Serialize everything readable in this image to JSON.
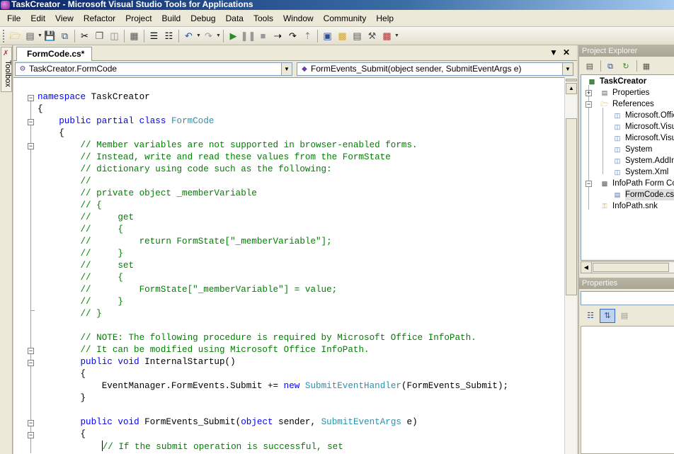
{
  "window": {
    "title": "TaskCreator - Microsoft Visual Studio Tools for Applications"
  },
  "menu": [
    "File",
    "Edit",
    "View",
    "Refactor",
    "Project",
    "Build",
    "Debug",
    "Data",
    "Tools",
    "Window",
    "Community",
    "Help"
  ],
  "toolbox": {
    "label": "Toolbox"
  },
  "editor": {
    "tab_label": "FormCode.cs*",
    "type_combo": "TaskCreator.FormCode",
    "member_combo": "FormEvents_Submit(object sender, SubmitEventArgs e)",
    "code_lines": [
      [
        {
          "t": "namespace",
          "c": "kw"
        },
        {
          "t": " TaskCreator",
          "c": ""
        }
      ],
      [
        {
          "t": "{",
          "c": ""
        }
      ],
      [
        {
          "t": "    ",
          "c": ""
        },
        {
          "t": "public",
          "c": "kw"
        },
        {
          "t": " ",
          "c": ""
        },
        {
          "t": "partial",
          "c": "kw"
        },
        {
          "t": " ",
          "c": ""
        },
        {
          "t": "class",
          "c": "kw"
        },
        {
          "t": " ",
          "c": ""
        },
        {
          "t": "FormCode",
          "c": "ty"
        }
      ],
      [
        {
          "t": "    {",
          "c": ""
        }
      ],
      [
        {
          "t": "        ",
          "c": ""
        },
        {
          "t": "// Member variables are not supported in browser-enabled forms.",
          "c": "cm"
        }
      ],
      [
        {
          "t": "        ",
          "c": ""
        },
        {
          "t": "// Instead, write and read these values from the FormState",
          "c": "cm"
        }
      ],
      [
        {
          "t": "        ",
          "c": ""
        },
        {
          "t": "// dictionary using code such as the following:",
          "c": "cm"
        }
      ],
      [
        {
          "t": "        ",
          "c": ""
        },
        {
          "t": "//",
          "c": "cm"
        }
      ],
      [
        {
          "t": "        ",
          "c": ""
        },
        {
          "t": "// private object _memberVariable",
          "c": "cm"
        }
      ],
      [
        {
          "t": "        ",
          "c": ""
        },
        {
          "t": "// {",
          "c": "cm"
        }
      ],
      [
        {
          "t": "        ",
          "c": ""
        },
        {
          "t": "//     get",
          "c": "cm"
        }
      ],
      [
        {
          "t": "        ",
          "c": ""
        },
        {
          "t": "//     {",
          "c": "cm"
        }
      ],
      [
        {
          "t": "        ",
          "c": ""
        },
        {
          "t": "//         return FormState[\"_memberVariable\"];",
          "c": "cm"
        }
      ],
      [
        {
          "t": "        ",
          "c": ""
        },
        {
          "t": "//     }",
          "c": "cm"
        }
      ],
      [
        {
          "t": "        ",
          "c": ""
        },
        {
          "t": "//     set",
          "c": "cm"
        }
      ],
      [
        {
          "t": "        ",
          "c": ""
        },
        {
          "t": "//     {",
          "c": "cm"
        }
      ],
      [
        {
          "t": "        ",
          "c": ""
        },
        {
          "t": "//         FormState[\"_memberVariable\"] = value;",
          "c": "cm"
        }
      ],
      [
        {
          "t": "        ",
          "c": ""
        },
        {
          "t": "//     }",
          "c": "cm"
        }
      ],
      [
        {
          "t": "        ",
          "c": ""
        },
        {
          "t": "// }",
          "c": "cm"
        }
      ],
      [
        {
          "t": "",
          "c": ""
        }
      ],
      [
        {
          "t": "        ",
          "c": ""
        },
        {
          "t": "// NOTE: The following procedure is required by Microsoft Office InfoPath.",
          "c": "cm"
        }
      ],
      [
        {
          "t": "        ",
          "c": ""
        },
        {
          "t": "// It can be modified using Microsoft Office InfoPath.",
          "c": "cm"
        }
      ],
      [
        {
          "t": "        ",
          "c": ""
        },
        {
          "t": "public",
          "c": "kw"
        },
        {
          "t": " ",
          "c": ""
        },
        {
          "t": "void",
          "c": "kw"
        },
        {
          "t": " InternalStartup()",
          "c": ""
        }
      ],
      [
        {
          "t": "        {",
          "c": ""
        }
      ],
      [
        {
          "t": "            EventManager.FormEvents.Submit += ",
          "c": ""
        },
        {
          "t": "new",
          "c": "kw"
        },
        {
          "t": " ",
          "c": ""
        },
        {
          "t": "SubmitEventHandler",
          "c": "ty"
        },
        {
          "t": "(FormEvents_Submit);",
          "c": ""
        }
      ],
      [
        {
          "t": "        }",
          "c": ""
        }
      ],
      [
        {
          "t": "",
          "c": ""
        }
      ],
      [
        {
          "t": "        ",
          "c": ""
        },
        {
          "t": "public",
          "c": "kw"
        },
        {
          "t": " ",
          "c": ""
        },
        {
          "t": "void",
          "c": "kw"
        },
        {
          "t": " FormEvents_Submit(",
          "c": ""
        },
        {
          "t": "object",
          "c": "kw"
        },
        {
          "t": " sender, ",
          "c": ""
        },
        {
          "t": "SubmitEventArgs",
          "c": "ty"
        },
        {
          "t": " e)",
          "c": ""
        }
      ],
      [
        {
          "t": "        {",
          "c": ""
        }
      ],
      [
        {
          "t": "            ",
          "c": ""
        },
        {
          "t": "CARET",
          "c": "caret"
        },
        {
          "t": "// If the submit operation is successful, set",
          "c": "cm"
        }
      ]
    ]
  },
  "project_explorer": {
    "title": "Project Explorer",
    "nodes": [
      {
        "label": "TaskCreator",
        "icon": "project-icon"
      },
      {
        "label": "Properties",
        "icon": "properties-icon"
      },
      {
        "label": "References",
        "icon": "folder-icon"
      },
      {
        "label": "Microsoft.Office",
        "icon": "reference-icon"
      },
      {
        "label": "Microsoft.Visual",
        "icon": "reference-icon"
      },
      {
        "label": "Microsoft.Visual",
        "icon": "reference-icon"
      },
      {
        "label": "System",
        "icon": "reference-icon"
      },
      {
        "label": "System.AddIn",
        "icon": "reference-icon"
      },
      {
        "label": "System.Xml",
        "icon": "reference-icon"
      },
      {
        "label": "InfoPath Form Co",
        "icon": "form-icon"
      },
      {
        "label": "FormCode.cs",
        "icon": "cs-file-icon"
      },
      {
        "label": "InfoPath.snk",
        "icon": "key-file-icon"
      }
    ]
  },
  "properties_pane": {
    "title": "Properties"
  }
}
